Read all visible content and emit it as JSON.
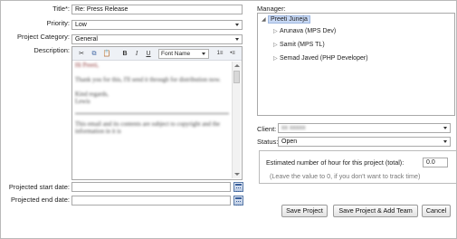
{
  "form": {
    "title_label": "Title*:",
    "title_value": "Re: Press Release",
    "priority_label": "Priority:",
    "priority_value": "Low",
    "category_label": "Project Category:",
    "category_value": "General",
    "description_label": "Description:",
    "start_date_label": "Projected start date:",
    "end_date_label": "Projected end date:",
    "start_date_value": "",
    "end_date_value": ""
  },
  "editor": {
    "toolbar": {
      "cut": "✂",
      "copy": "⧉",
      "paste": "📋",
      "bold": "B",
      "italic": "I",
      "underline": "U",
      "font": "Font Name",
      "ordered_list": "1≡",
      "bullet_list": "•≡"
    },
    "content": {
      "greeting": "Hi Preeti,",
      "line1": "Thank you for this, I'll send it through for distribution now.",
      "line2": "Kind regards,",
      "line3": "Lewis",
      "line4": "This email and its contents are subject to copyright and the information in it is"
    }
  },
  "manager": {
    "label": "Manager:",
    "root": "Preeti Juneja",
    "children": [
      "Arunava (MPS Dev)",
      "Samit (MPS TL)",
      "Semad Javed (PHP Developer)"
    ]
  },
  "client": {
    "label": "Client:",
    "value": "xx xxxxx"
  },
  "status": {
    "label": "Status:",
    "value": "Open"
  },
  "hours": {
    "label": "Estimated number of hour for this project (total):",
    "value": "0.0",
    "hint": "(Leave the value to 0, if you don't want to track time)"
  },
  "buttons": {
    "save": "Save Project",
    "save_team": "Save Project & Add Team",
    "cancel": "Cancel"
  }
}
